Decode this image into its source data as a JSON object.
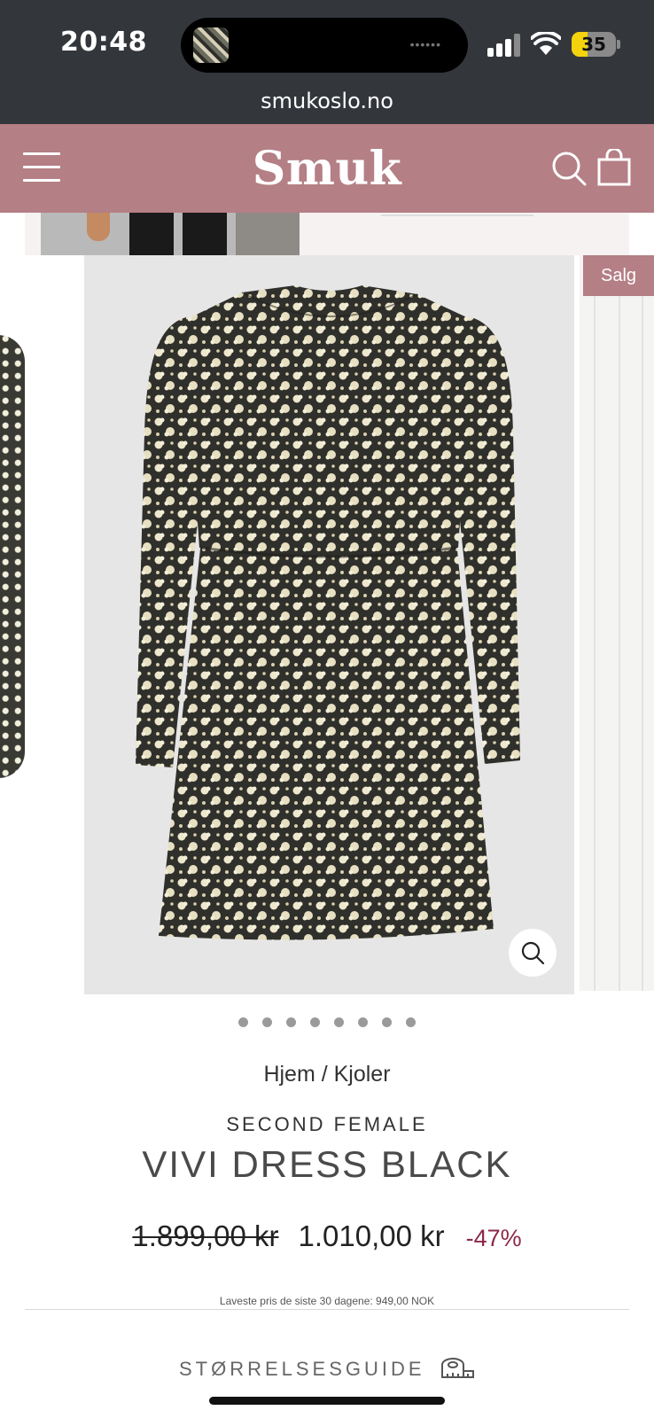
{
  "status_bar": {
    "time": "20:48",
    "battery_level": "35",
    "battery_fraction": 0.35,
    "island_dots": "••••••"
  },
  "browser": {
    "url": "smukoslo.no"
  },
  "site_header": {
    "logo": "Smuk",
    "menu_icon": "hamburger-menu-icon",
    "search_icon": "search-icon",
    "cart_icon": "shopping-bag-icon",
    "brand_color": "#b47f85"
  },
  "gallery": {
    "sale_badge": "Salg",
    "zoom_icon": "zoom-icon",
    "dots_total": 8,
    "active_dot": 1
  },
  "product": {
    "breadcrumb_home": "Hjem",
    "breadcrumb_sep": " / ",
    "breadcrumb_category": "Kjoler",
    "brand": "SECOND FEMALE",
    "title": "VIVI DRESS BLACK",
    "price_old": "1.899,00 kr",
    "price_new": "1.010,00 kr",
    "discount": "-47%",
    "discount_color": "#8c2a48",
    "lowest_price_note": "Laveste pris de siste 30 dagene: 949,00 NOK",
    "size_guide_label": "STØRRELSESGUIDE",
    "size_guide_icon": "ruler-icon"
  }
}
